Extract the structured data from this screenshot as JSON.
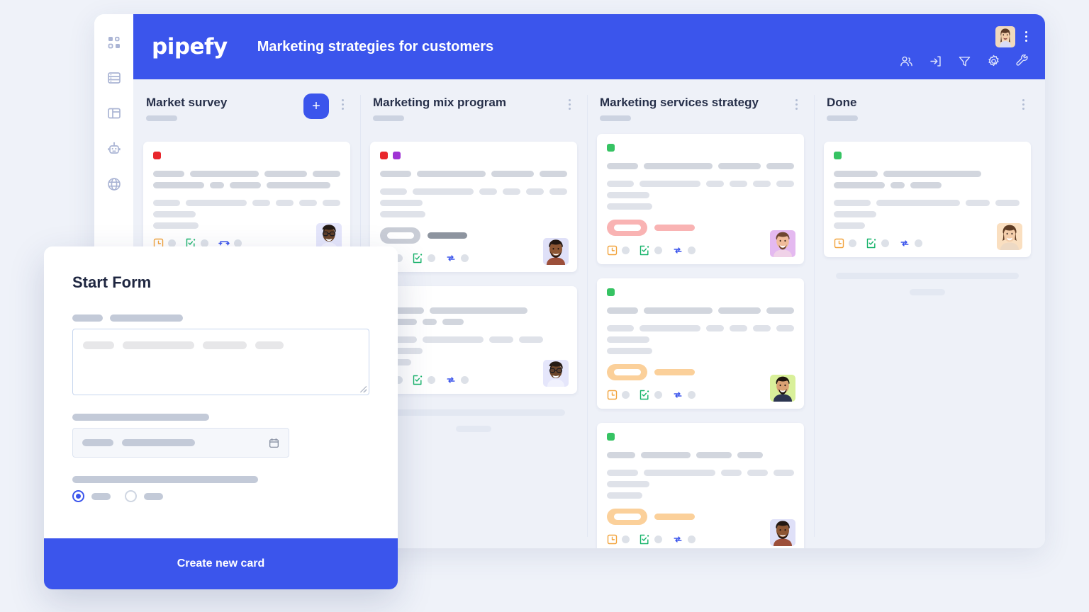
{
  "app": {
    "brand": "pipefy",
    "board_title": "Marketing strategies for customers",
    "accent": "#3b55ec",
    "board_bg": "#eef1f8",
    "page_bg": "#eff2f9"
  },
  "sidebar": {
    "items": [
      {
        "name": "apps-grid-icon",
        "label": "Apps"
      },
      {
        "name": "database-icon",
        "label": "Database"
      },
      {
        "name": "layout-icon",
        "label": "Layout"
      },
      {
        "name": "robot-icon",
        "label": "Automations"
      },
      {
        "name": "globe-icon",
        "label": "Portals"
      }
    ]
  },
  "topbar": {
    "icons": [
      {
        "name": "members-icon",
        "label": "Members"
      },
      {
        "name": "import-icon",
        "label": "Import"
      },
      {
        "name": "filter-icon",
        "label": "Filter"
      },
      {
        "name": "gear-icon",
        "label": "Settings"
      },
      {
        "name": "wrench-icon",
        "label": "Tools"
      }
    ],
    "user_menu_label": "More options"
  },
  "board": {
    "columns": [
      {
        "title": "Market survey",
        "has_add_button": true,
        "add_label": "+",
        "cards": [
          {
            "chips": [
              "#e8262c"
            ],
            "badge": null,
            "avatar": "avatar-glasses-woman",
            "footer_icons": [
              "due-date-icon",
              "checklist-icon",
              "connection-icon"
            ]
          }
        ],
        "footer_skeleton": false
      },
      {
        "title": "Marketing mix program",
        "has_add_button": false,
        "cards": [
          {
            "chips": [
              "#e8262c",
              "#a033d4"
            ],
            "badge": {
              "color": "#c9cdd6",
              "bar": "#8d949f"
            },
            "avatar": "avatar-bearded-man",
            "footer_icons": [
              "due-date-icon",
              "checklist-icon",
              "sync-icon"
            ]
          },
          {
            "chips": [],
            "badge": null,
            "avatar": "avatar-glasses-woman",
            "footer_icons": [
              "due-date-icon",
              "checklist-icon",
              "sync-icon"
            ]
          }
        ],
        "footer_skeleton": true
      },
      {
        "title": "Marketing services strategy",
        "has_add_button": false,
        "cards": [
          {
            "chips": [
              "#36c363"
            ],
            "badge": {
              "color": "#f9b3b3",
              "bar": "#f9b3b3"
            },
            "avatar": "avatar-smiling-man",
            "footer_icons": [
              "due-date-icon",
              "checklist-icon",
              "sync-icon"
            ]
          },
          {
            "chips": [
              "#36c363"
            ],
            "badge": {
              "color": "#fbd09a",
              "bar": "#fbd09a"
            },
            "avatar": "avatar-young-man",
            "footer_icons": [
              "due-date-icon",
              "checklist-icon",
              "sync-icon"
            ]
          },
          {
            "chips": [
              "#36c363"
            ],
            "badge": {
              "color": "#fbd09a",
              "bar": "#fbd09a"
            },
            "avatar": "avatar-dark-man",
            "footer_icons": [
              "due-date-icon",
              "checklist-icon",
              "sync-icon"
            ]
          }
        ],
        "footer_skeleton": false
      },
      {
        "title": "Done",
        "has_add_button": false,
        "cards": [
          {
            "chips": [
              "#36c363"
            ],
            "badge": null,
            "avatar": "avatar-smiling-woman",
            "footer_icons": [
              "due-date-icon",
              "checklist-icon",
              "sync-icon"
            ]
          }
        ],
        "footer_skeleton": true
      }
    ]
  },
  "modal": {
    "title": "Start Form",
    "submit_label": "Create new card",
    "fields": [
      {
        "type": "textarea",
        "name": "description-field",
        "placeholder": ""
      },
      {
        "type": "date",
        "name": "date-field",
        "icon": "calendar-icon"
      },
      {
        "type": "radio-group",
        "name": "choice-field",
        "selected_index": 0,
        "options_count": 2
      }
    ]
  }
}
